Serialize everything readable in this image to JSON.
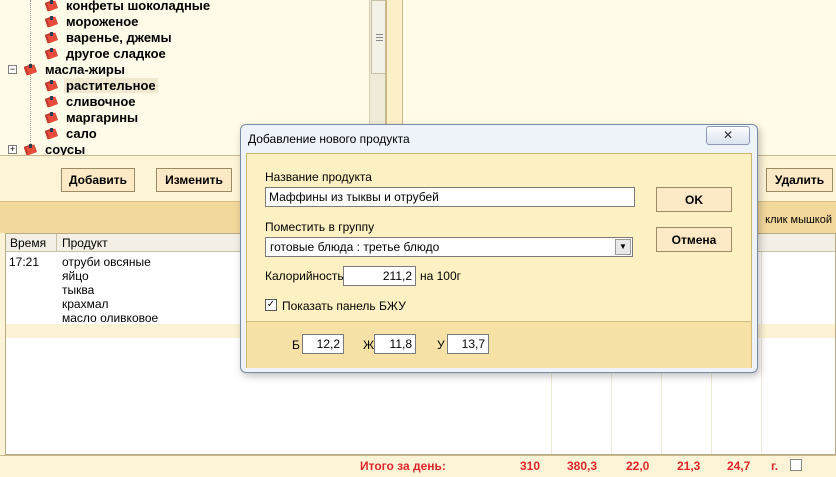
{
  "tree": {
    "items": [
      {
        "label": "конфеты шоколадные",
        "selected": false
      },
      {
        "label": "мороженое",
        "selected": false
      },
      {
        "label": "варенье, джемы",
        "selected": false
      },
      {
        "label": "другое сладкое",
        "selected": false
      },
      {
        "label": "масла-жиры",
        "selected": false,
        "expander": "⊟"
      },
      {
        "label": "растительное",
        "selected": true
      },
      {
        "label": "сливочное",
        "selected": false
      },
      {
        "label": "маргарины",
        "selected": false
      },
      {
        "label": "сало",
        "selected": false
      },
      {
        "label": "соусы",
        "selected": false,
        "expander": "⊞"
      }
    ],
    "icon": "food-category-icon",
    "icon_color": "#c0392b"
  },
  "toolbar": {
    "add_label": "Добавить",
    "edit_label": "Изменить",
    "delete_label": "Удалить"
  },
  "hint": "клик мышкой",
  "diary": {
    "columns": [
      "Время",
      "Продукт"
    ],
    "rows": [
      {
        "time": "17:21",
        "product": "отруби овсяные"
      },
      {
        "time": "",
        "product": "яйцо"
      },
      {
        "time": "",
        "product": "тыква"
      },
      {
        "time": "",
        "product": "крахмал"
      },
      {
        "time": "",
        "product": "масло оливковое"
      }
    ]
  },
  "totals": {
    "label": "Итого за день:",
    "kcal": "310",
    "weight": "380,3",
    "protein": "22,0",
    "fat": "21,3",
    "carbs": "24,7",
    "unit": "г."
  },
  "dialog": {
    "title": "Добавление нового продукта",
    "close_glyph": "✕",
    "name_label": "Название продукта",
    "name_value": "Маффины из тыквы и отрубей",
    "group_label": "Поместить в группу",
    "group_value": "готовые блюда : третье блюдо",
    "calorie_label": "Калорийность",
    "calorie_value": "211,2",
    "calorie_unit": "на 100г",
    "bju_check_label": "Показать панель БЖУ",
    "bju_checked": true,
    "ok_label": "OK",
    "cancel_label": "Отмена",
    "b_label": "Б",
    "b_value": "12,2",
    "zh_label": "Ж",
    "zh_value": "11,8",
    "u_label": "У",
    "u_value": "13,7"
  },
  "colors": {
    "accent_red": "#e0262a",
    "panel_bg": "#fdf3d6",
    "button_bg": "#fde9c5"
  }
}
